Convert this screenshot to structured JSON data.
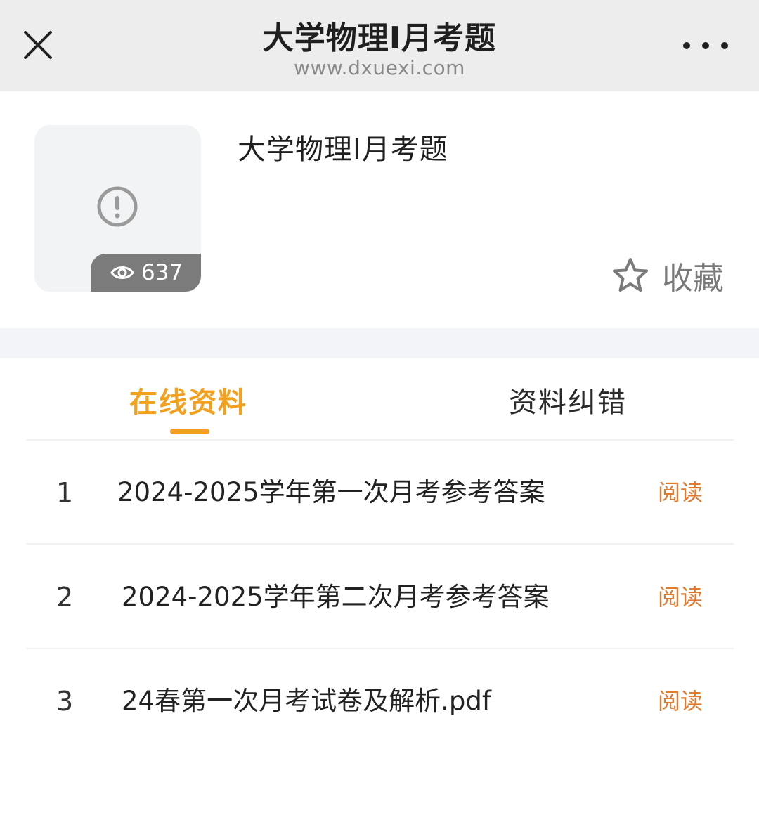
{
  "topbar": {
    "title": "大学物理I月考题",
    "url": "www.dxuexi.com"
  },
  "header": {
    "cover_icon": "warning-circle-icon",
    "views": "637",
    "title": "大学物理I月考题",
    "favorite_label": "收藏"
  },
  "tabs": [
    {
      "label": "在线资料",
      "active": true
    },
    {
      "label": "资料纠错",
      "active": false
    }
  ],
  "list": [
    {
      "index": "1",
      "name": "2024-2025学年第一次月考参考答案",
      "action": "阅读"
    },
    {
      "index": "2",
      "name": "2024-2025学年第二次月考参考答案",
      "action": "阅读"
    },
    {
      "index": "3",
      "name": "24春第一次月考试卷及解析.pdf",
      "action": "阅读"
    }
  ],
  "colors": {
    "accent": "#f2a01e",
    "read_link": "#e07a2d"
  }
}
